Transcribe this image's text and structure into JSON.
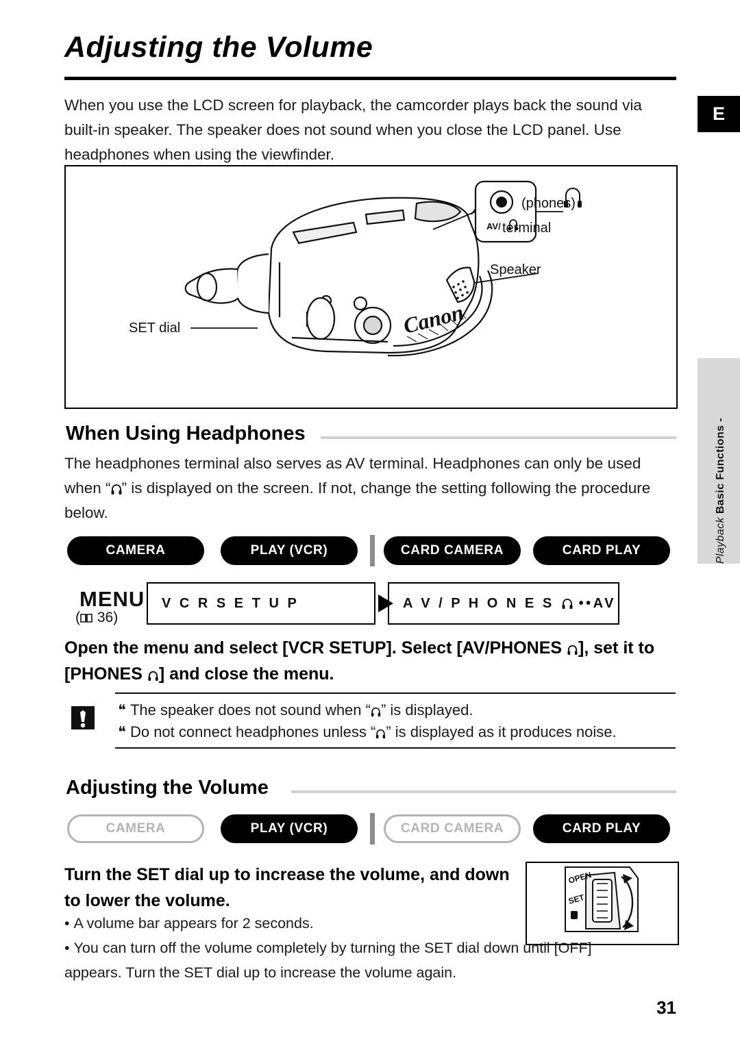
{
  "page": {
    "title": "Adjusting the Volume",
    "number": "31",
    "lang_tab": "E",
    "side_tab": {
      "line_bold": "Basic Functions -",
      "line_italic": "Playback"
    }
  },
  "intro": "When you use the LCD screen for playback, the camcorder plays back the sound via built-in speaker. The speaker does not sound when you close the LCD panel. Use headphones when using the viewfinder.",
  "figure": {
    "labels": {
      "phones_terminal_line1": "(phones)",
      "phones_terminal_line2": "terminal",
      "speaker": "Speaker",
      "set_dial": "SET dial",
      "jack_text": "AV/",
      "brand": "Canon"
    }
  },
  "section_headphones": {
    "heading": "When Using Headphones",
    "paragraph": "The headphones terminal also serves as AV terminal. Headphones can only be used when “ ” is displayed on the screen. If not, change the setting following the procedure below.",
    "modes": [
      {
        "label": "CAMERA",
        "state": "on"
      },
      {
        "label": "PLAY (VCR)",
        "state": "on"
      },
      {
        "label": "CARD CAMERA",
        "state": "on"
      },
      {
        "label": "CARD PLAY",
        "state": "on"
      }
    ],
    "menu_word": "MENU",
    "menu_ref": "36",
    "menu_box_left": "V C R   S E T U P",
    "menu_box_right": "A V / P H O N E S         • • A V",
    "instruction_line1": "Open the menu and select [VCR SETUP]. Select [AV/PHONES    ], set it to",
    "instruction_line2": "[PHONES    ] and close the menu.",
    "cautions": [
      "The speaker does not sound when “  ” is displayed.",
      "Do not connect headphones unless “  ” is displayed as it produces noise."
    ]
  },
  "section_volume": {
    "heading": "Adjusting the Volume",
    "modes": [
      {
        "label": "CAMERA",
        "state": "off"
      },
      {
        "label": "PLAY (VCR)",
        "state": "on"
      },
      {
        "label": "CARD CAMERA",
        "state": "off"
      },
      {
        "label": "CARD PLAY",
        "state": "on"
      }
    ],
    "instruction_line1": "Turn the SET dial up to increase the volume, and down",
    "instruction_line2": "to lower the volume.",
    "bullets": [
      "A volume bar appears for 2 seconds.",
      "You can turn off the volume completely by turning the SET dial down until [OFF] appears. Turn the SET dial up to increase the volume again."
    ],
    "dial_labels": {
      "open": "OPEN",
      "set": "SET"
    }
  }
}
